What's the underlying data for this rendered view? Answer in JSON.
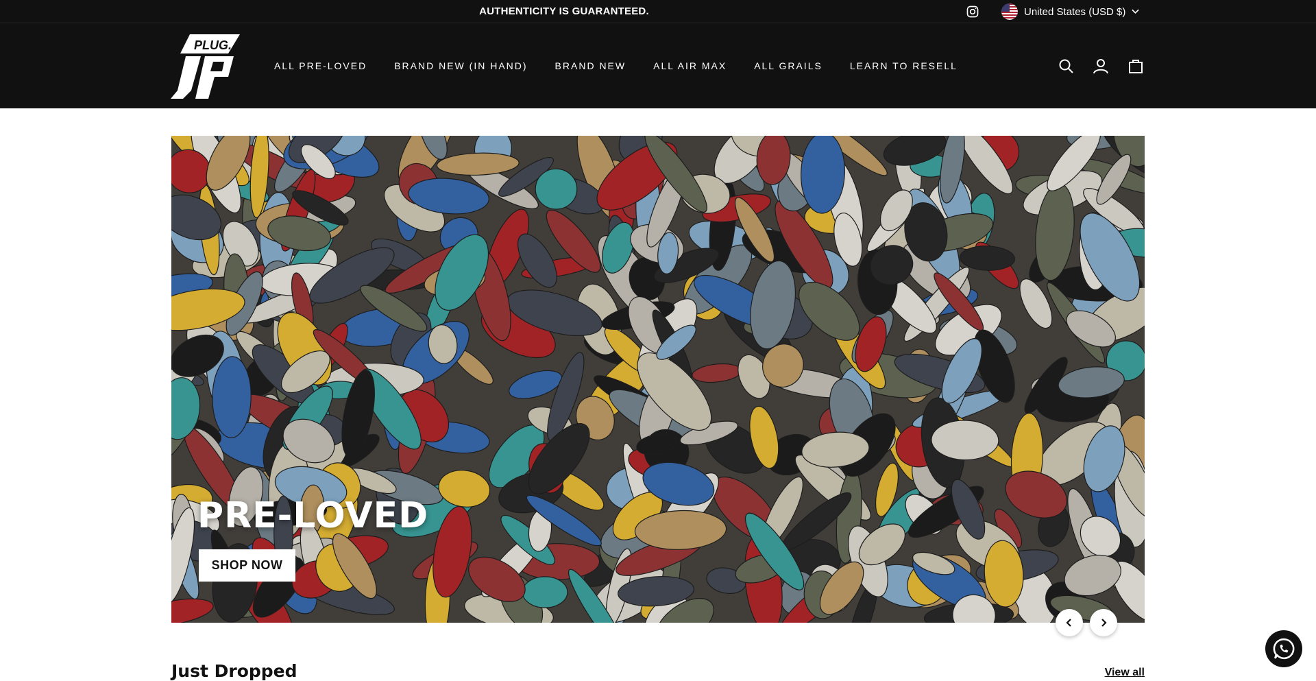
{
  "announcement": {
    "text": "AUTHENTICITY IS GUARANTEED."
  },
  "top_bar": {
    "instagram_icon": "instagram-icon",
    "locale_label": "United States (USD $)",
    "flag_icon": "us-flag-icon"
  },
  "header": {
    "logo_text": "PLUG.",
    "logo_monogram": "JP",
    "nav": [
      {
        "label": "ALL PRE-LOVED"
      },
      {
        "label": "BRAND NEW (IN HAND)"
      },
      {
        "label": "BRAND NEW"
      },
      {
        "label": "ALL AIR MAX"
      },
      {
        "label": "ALL GRAILS"
      },
      {
        "label": "LEARN TO RESELL"
      }
    ],
    "icons": [
      "search-icon",
      "account-icon",
      "cart-icon"
    ]
  },
  "hero": {
    "title": "PRE-LOVED",
    "button_label": "SHOP NOW",
    "image": "pile of sneakers photo"
  },
  "slider": {
    "prev_icon": "chevron-left-icon",
    "next_icon": "chevron-right-icon"
  },
  "section": {
    "title": "Just Dropped",
    "view_all": "View all"
  },
  "chat": {
    "icon": "whatsapp-icon"
  },
  "colors": {
    "header_bg": "#111111",
    "text_light": "#ffffff",
    "button_bg": "#ffffff"
  }
}
